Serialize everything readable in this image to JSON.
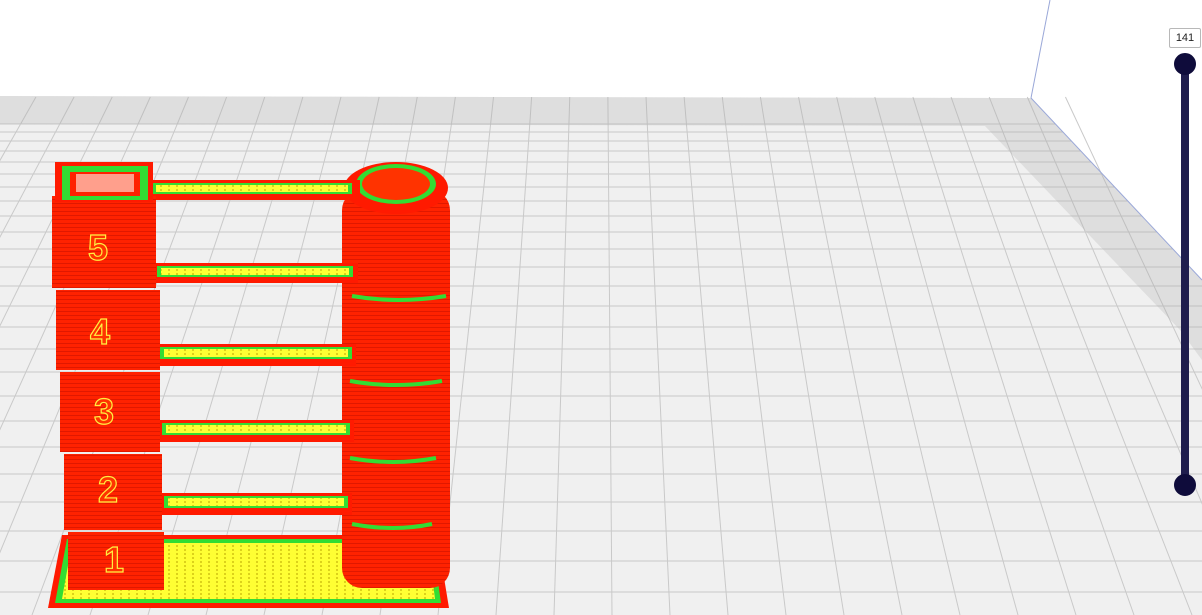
{
  "layer_slider": {
    "current_layer_label": "141",
    "min_handle": "layer-min-handle",
    "max_handle": "layer-max-handle"
  },
  "model": {
    "tower_numbers": [
      "1",
      "2",
      "3",
      "4",
      "5"
    ]
  },
  "colors": {
    "background": "#ffffff",
    "build_plate": "#f0f0f0",
    "grid_line": "#c9c9c9",
    "plate_border": "#bdbdbd",
    "wall_outer": "#ff1a00",
    "wall_inner": "#33dd33",
    "infill": "#ffff33",
    "slider": "#1f1d4d"
  }
}
